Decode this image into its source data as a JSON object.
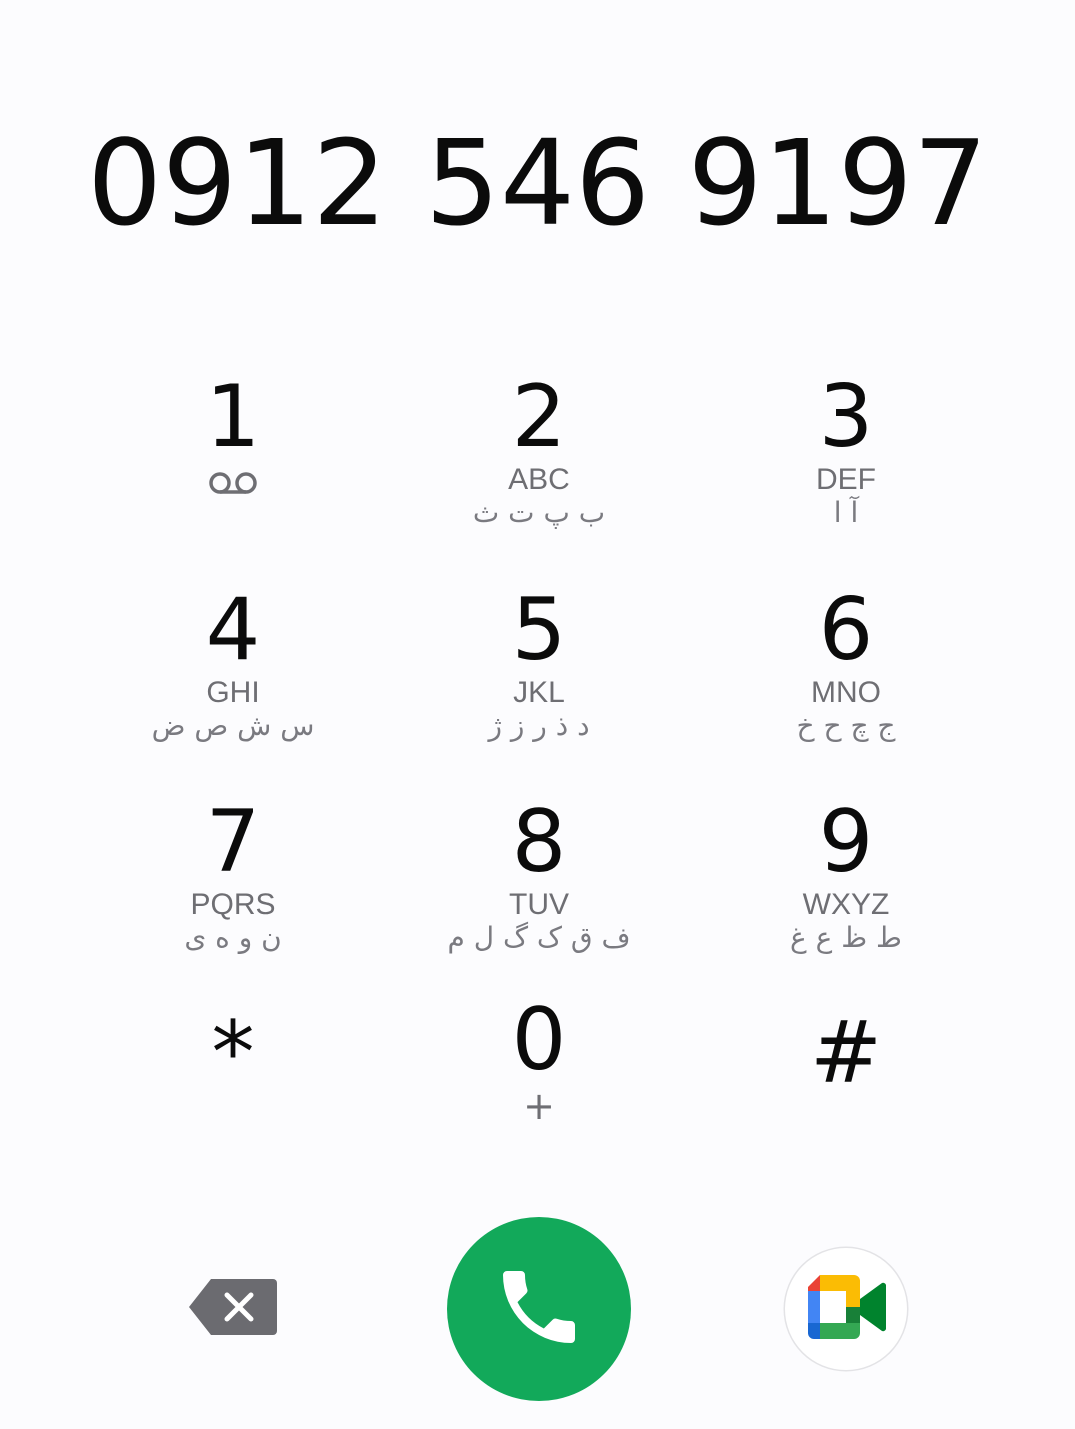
{
  "dialer": {
    "number": "0912 546 9197"
  },
  "keys": [
    {
      "digit": "1",
      "letters": "",
      "persian": "",
      "icon": "voicemail-icon"
    },
    {
      "digit": "2",
      "letters": "ABC",
      "persian": "ب پ ت ث"
    },
    {
      "digit": "3",
      "letters": "DEF",
      "persian": "آ ا"
    },
    {
      "digit": "4",
      "letters": "GHI",
      "persian": "س ش ص ض"
    },
    {
      "digit": "5",
      "letters": "JKL",
      "persian": "د ذ ر ز ژ"
    },
    {
      "digit": "6",
      "letters": "MNO",
      "persian": "ج چ ح خ"
    },
    {
      "digit": "7",
      "letters": "PQRS",
      "persian": "ن و ه ی"
    },
    {
      "digit": "8",
      "letters": "TUV",
      "persian": "ف ق ک گ ل م"
    },
    {
      "digit": "9",
      "letters": "WXYZ",
      "persian": "ط ظ ع غ"
    },
    {
      "digit": "*",
      "letters": "",
      "persian": ""
    },
    {
      "digit": "0",
      "letters": "+",
      "persian": ""
    },
    {
      "digit": "#",
      "letters": "",
      "persian": ""
    }
  ],
  "actions": {
    "backspace_icon": "backspace-icon",
    "call_icon": "phone-icon",
    "video_icon": "google-meet-icon",
    "call_color": "#12a95a",
    "backspace_color": "#6b6b70"
  }
}
